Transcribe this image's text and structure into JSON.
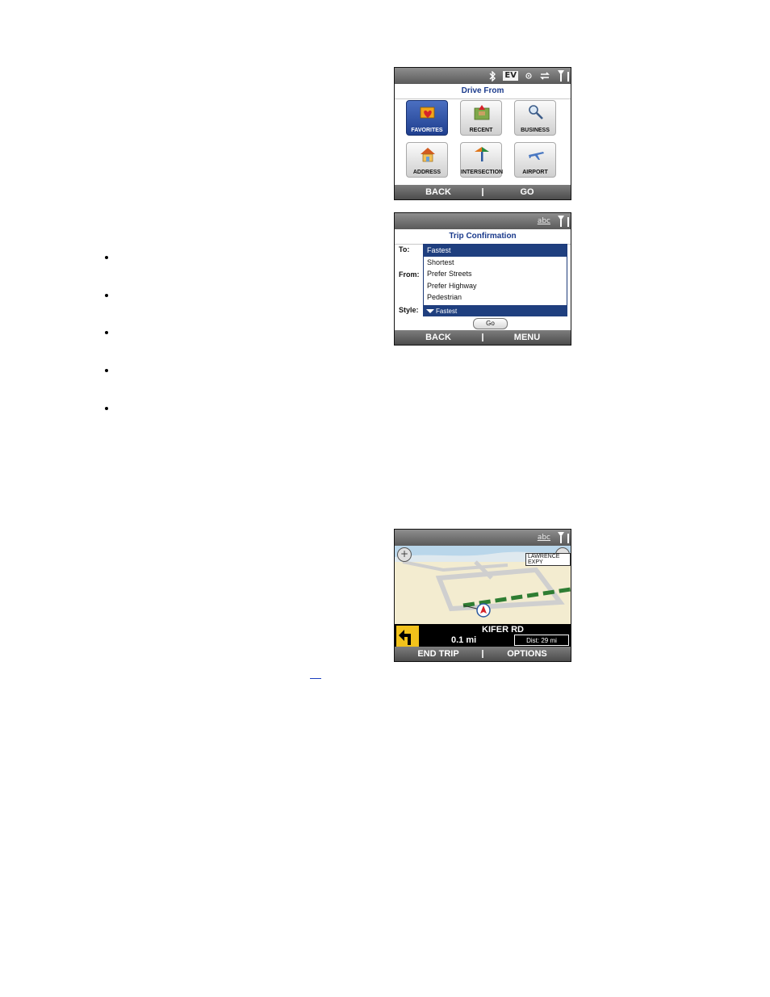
{
  "screen1": {
    "title": "Drive From",
    "status": {
      "ev_label": "EV"
    },
    "tiles": [
      {
        "label": "FAVORITES",
        "icon": "favorites-folder-icon",
        "selected": true
      },
      {
        "label": "RECENT",
        "icon": "recent-map-icon",
        "selected": false
      },
      {
        "label": "BUSINESS",
        "icon": "business-search-icon",
        "selected": false
      },
      {
        "label": "ADDRESS",
        "icon": "address-house-icon",
        "selected": false
      },
      {
        "label": "INTERSECTION",
        "icon": "intersection-sign-icon",
        "selected": false
      },
      {
        "label": "AIRPORT",
        "icon": "airport-plane-icon",
        "selected": false
      }
    ],
    "softkeys": {
      "left": "BACK",
      "right": "GO"
    }
  },
  "screen2": {
    "title": "Trip Confirmation",
    "status": {
      "input_mode": "abc"
    },
    "labels": {
      "to": "To:",
      "from": "From:",
      "style": "Style:"
    },
    "options": [
      "Fastest",
      "Shortest",
      "Prefer Streets",
      "Prefer Highway",
      "Pedestrian"
    ],
    "selected_option": "Fastest",
    "style_value": "Fastest",
    "go_label": "Go",
    "softkeys": {
      "left": "BACK",
      "right": "MENU"
    }
  },
  "screen3": {
    "status": {
      "input_mode": "abc"
    },
    "map_label": "LAWRENCE EXPY",
    "street": "KIFER RD",
    "distance": "0.1 mi",
    "total_distance": "Dist: 29 mi",
    "softkeys": {
      "left": "END TRIP",
      "right": "OPTIONS"
    }
  },
  "colors": {
    "accent": "#1f3f7f",
    "turn_arrow_bg": "#f2c21b"
  }
}
